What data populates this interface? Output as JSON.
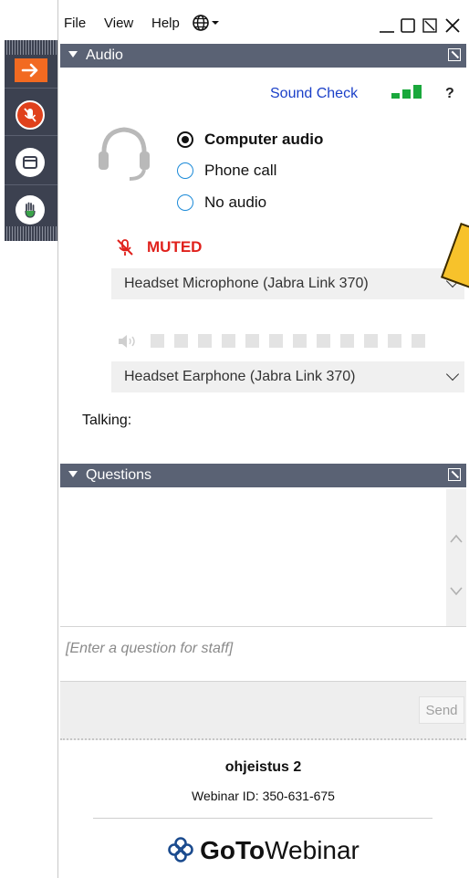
{
  "menu": {
    "file": "File",
    "view": "View",
    "help": "Help"
  },
  "audio": {
    "header": "Audio",
    "sound_check": "Sound Check",
    "help_mark": "?",
    "options": {
      "computer": "Computer audio",
      "phone": "Phone call",
      "none": "No audio"
    },
    "selected_option": "Computer audio",
    "mute_status": "MUTED",
    "microphone": "Headset Microphone (Jabra Link 370)",
    "speaker": "Headset Earphone (Jabra Link 370)",
    "talking_label": "Talking:",
    "meter_segments": 12,
    "signal_bars_active": 3,
    "colors": {
      "muted": "#e0211c",
      "signal": "#1aa83c"
    }
  },
  "questions": {
    "header": "Questions",
    "placeholder": "[Enter a question for staff]",
    "send": "Send"
  },
  "footer": {
    "webinar_title": "ohjeistus 2",
    "webinar_id": "Webinar ID: 350-631-675",
    "brand_bold": "GoTo",
    "brand_light": "Webinar"
  },
  "accent_colors": {
    "header": "#5a6274",
    "sidebar": "#3c4150",
    "orange": "#f26a21",
    "red": "#e0411c"
  }
}
